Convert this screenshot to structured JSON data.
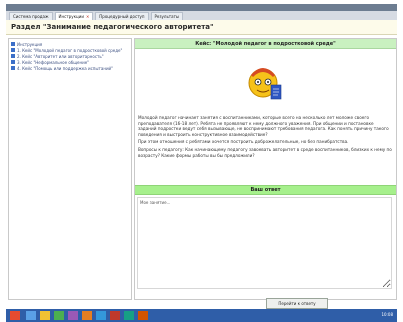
{
  "browser": {
    "tabs": [
      {
        "label": "Система продаж",
        "active": false
      },
      {
        "label": "Инструкции",
        "active": true
      },
      {
        "label": "Процедурный доступ",
        "active": false
      },
      {
        "label": "Результаты",
        "active": false
      }
    ]
  },
  "section": {
    "title": "Раздел \"Занимание педагогического авторитета\""
  },
  "sidebar": {
    "items": [
      {
        "label": "Инструкция"
      },
      {
        "label": "1. Кейс \"Молодой педагог в подростковой среде\""
      },
      {
        "label": "2. Кейс \"Авторитет или авторитарность\""
      },
      {
        "label": "3. Кейс \"Неформальное общение\""
      },
      {
        "label": "4. Кейс \"Помощь или поддержка испытаний\""
      }
    ]
  },
  "case": {
    "title": "Кейс: \"Молодой педагог в подростковой среде\"",
    "paragraphs": [
      "Молодой педагог начинает занятия с воспитанниками, которые всего на несколько лет моложе своего преподавателя (16-18 лет). Ребята не проявляют к нему должного уважения. При общении и постановке заданий подростки ведут себя вызывающе, не воспринимают требования педагога. Как понять причину такого поведения и выстроить конструктивное взаимодействие?",
      "При этом отношения с ребятами хочется построить доброжелательные, но без панибратства.",
      "Вопросы к педагогу: Как начинающему педагогу завоевать авторитет в среде воспитанников, близких к нему по возрасту? Какие формы работы вы бы предложили?"
    ]
  },
  "answer": {
    "title": "Ваш ответ",
    "value": "Мое занятие..."
  },
  "submit_label": "Перейти к ответу",
  "tray": {
    "time": "10:08"
  },
  "colors": {
    "header_green": "#c9f1c0",
    "answer_green": "#a6f08c",
    "taskbar": "#2f5ea8",
    "section_bg": "#fdfbea"
  }
}
